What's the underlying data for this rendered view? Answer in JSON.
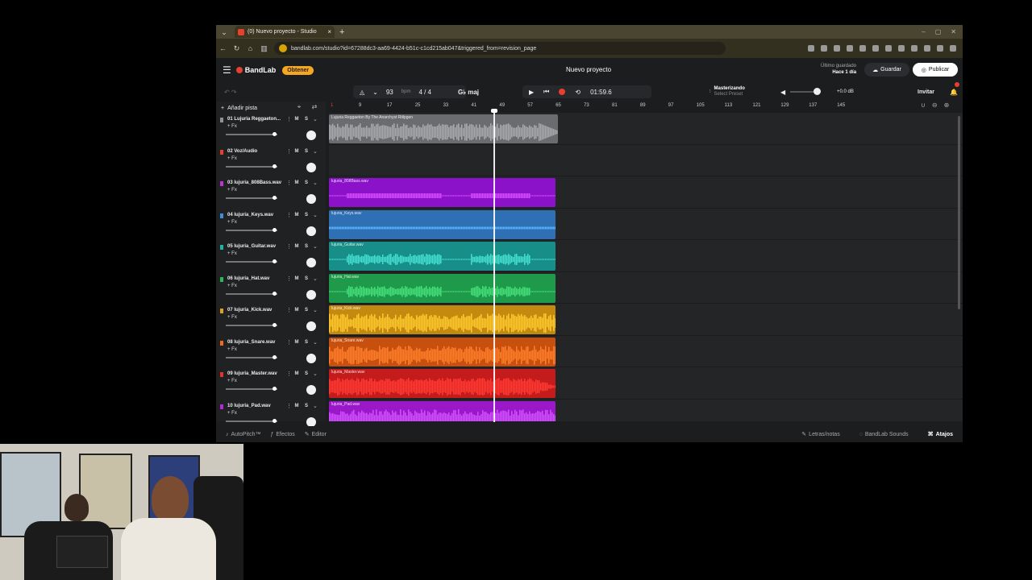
{
  "browser": {
    "tab_title": "(0) Nuevo proyecto - Studio",
    "tab_close": "×",
    "new_tab": "+",
    "url": "bandlab.com/studio?id=67288dc3-aa69-4424-b51c-c1cd215ab047&triggered_from=revision_page"
  },
  "app": {
    "logo": "BandLab",
    "obtener": "Obtener",
    "project_title": "Nuevo proyecto",
    "saved_line1": "Último guardado",
    "saved_line2": "Hace 1 día",
    "guardar": "Guardar",
    "publicar": "Publicar"
  },
  "transport": {
    "bpm": "93",
    "bpm_unit": "bpm",
    "time_signature": "4 / 4",
    "key": "G♭ maj",
    "time": "01:59.6",
    "mastering_title": "Masterizando",
    "mastering_sub": "Select Preset",
    "db": "+0.0 dB",
    "invitar": "Invitar",
    "master_volume": 0.82
  },
  "tracks_header": {
    "add_track": "Añadir pista"
  },
  "tracks": [
    {
      "name": "01 Lujuria Reggaeton...",
      "fx": "+ Fx",
      "m": "M",
      "s": "S",
      "color": "#8f9296",
      "clip": "Lujuria Reggaeton By The Anarchyst Ritlpgen",
      "clip_color": "#6a6c70",
      "wave_color": "#a8aaae",
      "volume": 0.95
    },
    {
      "name": "02 Voz/Audio",
      "fx": "+ Fx",
      "m": "M",
      "s": "S",
      "color": "#e8402f",
      "clip": "",
      "clip_color": "",
      "wave_color": "",
      "volume": 0.95
    },
    {
      "name": "03 lujuria_808Bass.wav",
      "fx": "+ Fx",
      "m": "M",
      "s": "S",
      "color": "#c42ed6",
      "clip": "lujuria_808Bass.wav",
      "clip_color": "#8b12c8",
      "wave_color": "#d64bff",
      "volume": 0.95
    },
    {
      "name": "04 lujuria_Keys.wav",
      "fx": "+ Fx",
      "m": "M",
      "s": "S",
      "color": "#3b8fe0",
      "clip": "lujuria_Keys.wav",
      "clip_color": "#2f6fb4",
      "wave_color": "#5ab4ff",
      "volume": 0.95
    },
    {
      "name": "05 lujuria_Guitar.wav",
      "fx": "+ Fx",
      "m": "M",
      "s": "S",
      "color": "#1fb3a0",
      "clip": "lujuria_Guitar.wav",
      "clip_color": "#178e88",
      "wave_color": "#45e0d0",
      "volume": 0.95
    },
    {
      "name": "06 lujuria_Hat.wav",
      "fx": "+ Fx",
      "m": "M",
      "s": "S",
      "color": "#27b85a",
      "clip": "lujuria_Hat.wav",
      "clip_color": "#1f9a4a",
      "wave_color": "#45e07a",
      "volume": 0.95
    },
    {
      "name": "07 lujuria_Kick.wav",
      "fx": "+ Fx",
      "m": "M",
      "s": "S",
      "color": "#e0a020",
      "clip": "lujuria_Kick.wav",
      "clip_color": "#c48a10",
      "wave_color": "#ffc92e",
      "volume": 0.95
    },
    {
      "name": "08 lujuria_Snare.wav",
      "fx": "+ Fx",
      "m": "M",
      "s": "S",
      "color": "#f06a1a",
      "clip": "lujuria_Snare.wav",
      "clip_color": "#c7500e",
      "wave_color": "#ff7e2a",
      "volume": 0.95
    },
    {
      "name": "09 lujuria_Master.wav",
      "fx": "+ Fx",
      "m": "M",
      "s": "S",
      "color": "#e8302a",
      "clip": "lujuria_Master.wav",
      "clip_color": "#c41c1c",
      "wave_color": "#ff3a32",
      "volume": 0.95
    },
    {
      "name": "10 lujuria_Pad.wav",
      "fx": "+ Fx",
      "m": "M",
      "s": "S",
      "color": "#b02ad6",
      "clip": "lujuria_Pad.wav",
      "clip_color": "#9a18c8",
      "wave_color": "#d050ff",
      "volume": 0.95
    }
  ],
  "ruler": [
    "1",
    "9",
    "17",
    "25",
    "33",
    "41",
    "49",
    "57",
    "65",
    "73",
    "81",
    "89",
    "97",
    "105",
    "113",
    "121",
    "129",
    "137",
    "145"
  ],
  "bottom": {
    "autopitch": "AutoPitch™",
    "efectos": "Efectos",
    "editor": "Editor",
    "letras": "Letras/notas",
    "sounds": "BandLab Sounds",
    "atajos": "Atajos"
  }
}
